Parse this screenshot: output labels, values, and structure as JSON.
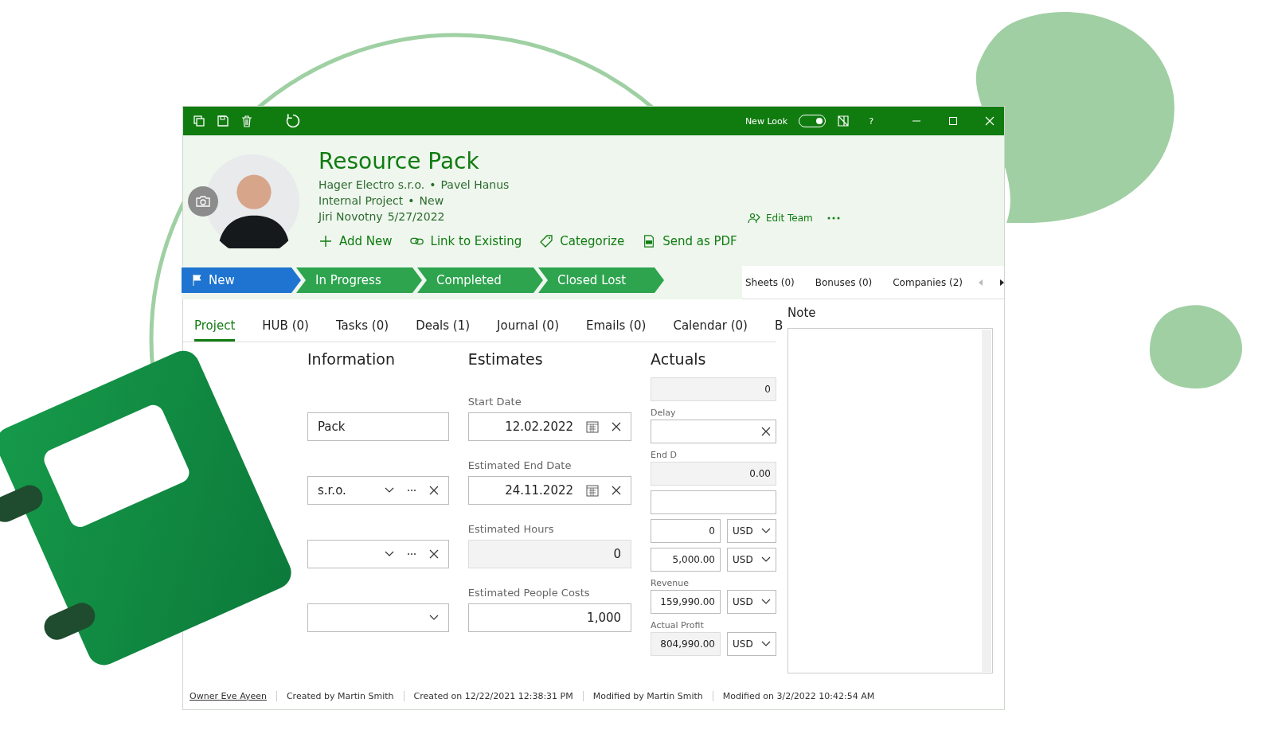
{
  "title_bar": {
    "new_look_label": "New Look",
    "new_look_on": true,
    "help": "?"
  },
  "record": {
    "title": "Resource Pack",
    "company": "Hager Electro s.r.o.",
    "contact": "Pavel Hanus",
    "type": "Internal Project",
    "stage": "New",
    "owner": "Jiri Novotny",
    "date": "5/27/2022",
    "separators": [
      "•",
      "•"
    ]
  },
  "actions": [
    {
      "kind": "add",
      "label": "Add New"
    },
    {
      "kind": "link",
      "label": "Link to Existing"
    },
    {
      "kind": "tag",
      "label": "Categorize"
    },
    {
      "kind": "pdf",
      "label": "Send as PDF"
    }
  ],
  "team_action": "Edit Team",
  "stages": [
    {
      "label": "New",
      "selected": true
    },
    {
      "label": "In Progress",
      "selected": false
    },
    {
      "label": "Completed",
      "selected": false
    },
    {
      "label": "Closed Lost",
      "selected": false
    }
  ],
  "side_tabs": [
    "Sheets (0)",
    "Bonuses (0)",
    "Companies (2)"
  ],
  "tabs": [
    {
      "label": "Project",
      "selected": true
    },
    {
      "label": "HUB (0)",
      "selected": false
    },
    {
      "label": "Tasks (0)",
      "selected": false
    },
    {
      "label": "Deals (1)",
      "selected": false
    },
    {
      "label": "Journal (0)",
      "selected": false
    },
    {
      "label": "Emails (0)",
      "selected": false
    },
    {
      "label": "Calendar (0)",
      "selected": false
    },
    {
      "label": "B",
      "selected": false
    }
  ],
  "sections": {
    "information": "Information",
    "estimates": "Estimates",
    "actuals": "Actuals"
  },
  "info_fields": [
    {
      "kind": "text",
      "value": "Pack"
    },
    {
      "kind": "lookup",
      "value": "s.r.o."
    },
    {
      "kind": "lookup"
    },
    {
      "kind": "select"
    }
  ],
  "estimate_fields": [
    {
      "label": "Start Date",
      "kind": "date",
      "value": "12.02.2022"
    },
    {
      "label": "Estimated End Date",
      "kind": "date",
      "value": "24.11.2022"
    },
    {
      "label": "Estimated Hours",
      "kind": "readonly",
      "value": "0"
    },
    {
      "label": "Estimated People Costs",
      "kind": "number",
      "value": "1,000"
    }
  ],
  "actual_fields": [
    {
      "kind": "readonly",
      "value": "0"
    },
    {
      "label": "Delay",
      "kind": "clear"
    },
    {
      "label": "End D",
      "kind": "readonly",
      "value": "0.00"
    },
    {
      "kind": "text"
    },
    {
      "kind": "money",
      "value": "0",
      "currency": "USD"
    },
    {
      "kind": "money",
      "value": "5,000.00",
      "currency": "USD"
    },
    {
      "label": "Revenue",
      "kind": "money",
      "value": "159,990.00",
      "currency": "USD"
    },
    {
      "label": "Actual Profit",
      "kind": "money-readonly",
      "value": "804,990.00",
      "currency": "USD"
    }
  ],
  "note": {
    "label": "Note"
  },
  "status_bar": [
    {
      "kind": "link",
      "text": "Owner Eve Ayeen"
    },
    {
      "kind": "text",
      "text": "Created by Martin Smith"
    },
    {
      "kind": "text",
      "text": "Created on 12/22/2021 12:38:31 PM"
    },
    {
      "kind": "text",
      "text": "Modified by Martin Smith"
    },
    {
      "kind": "text",
      "text": "Modified on 3/2/2022 10:42:54 AM"
    }
  ]
}
